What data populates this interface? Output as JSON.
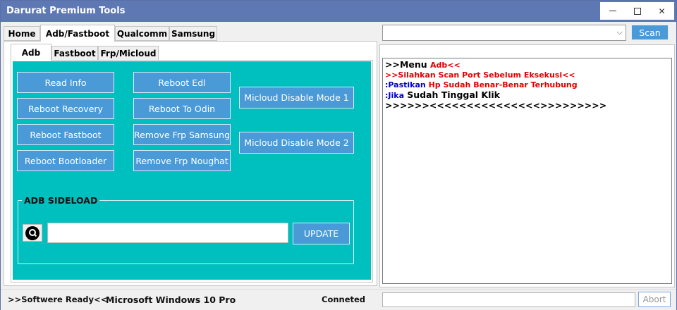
{
  "window": {
    "title": "Darurat Premium Tools",
    "controls": [
      "minimize",
      "maximize",
      "close"
    ]
  },
  "main_tabs": [
    {
      "label": "Home",
      "active": false
    },
    {
      "label": "Adb/Fastboot",
      "active": true
    },
    {
      "label": "Qualcomm",
      "active": false
    },
    {
      "label": "Samsung",
      "active": false
    }
  ],
  "sub_tabs": [
    {
      "label": "Adb",
      "active": true
    },
    {
      "label": "Fastboot",
      "active": false
    },
    {
      "label": "Frp/Micloud",
      "active": false
    }
  ],
  "adb_buttons": {
    "read_info": "Read Info",
    "reboot_recovery": "Reboot Recovery",
    "reboot_fastboot": "Reboot Fastboot",
    "reboot_bootloader": "Reboot Bootloader",
    "reboot_edl": "Reboot Edl",
    "reboot_to_odin": "Reboot To Odin",
    "remove_frp_samsung": "Remove Frp Samsung",
    "remove_frp_noughat": "Remove Frp Noughat",
    "micloud_disable_mode_1": "Micloud Disable Mode 1",
    "micloud_disable_mode_2": "Micloud Disable Mode 2"
  },
  "sideload": {
    "title": "ADB SIDELOAD",
    "file_value": "",
    "update_label": "UPDATE"
  },
  "port": {
    "selected": "",
    "scan_label": "Scan"
  },
  "log": {
    "line1": {
      "prefix": ">>Menu",
      "highlight": "Adb<<"
    },
    "line2": {
      "text": ">>Silahkan Scan Port Sebelum Eksekusi<<"
    },
    "line3": {
      "prefix": ":Pastikan",
      "rest": "Hp Sudah Benar-Benar Terhubung"
    },
    "line4": {
      "prefix": ":Jika",
      "rest": "Sudah Tinggal Klik"
    },
    "line5": {
      "text": ">>>>>><<<<<<<<<<<<<<<>>>>>>>>>"
    }
  },
  "status": {
    "ready": ">>Softwere Ready<<",
    "os": "Microsoft Windows 10 Pro",
    "connection": "Conneted",
    "progress_text": "",
    "abort_label": "Abort"
  },
  "colors": {
    "titlebar": "#5d78b3",
    "panel": "#00bfbf",
    "button": "#4a9ad8",
    "log_red": "#e00000",
    "log_blue": "#0000cc"
  }
}
